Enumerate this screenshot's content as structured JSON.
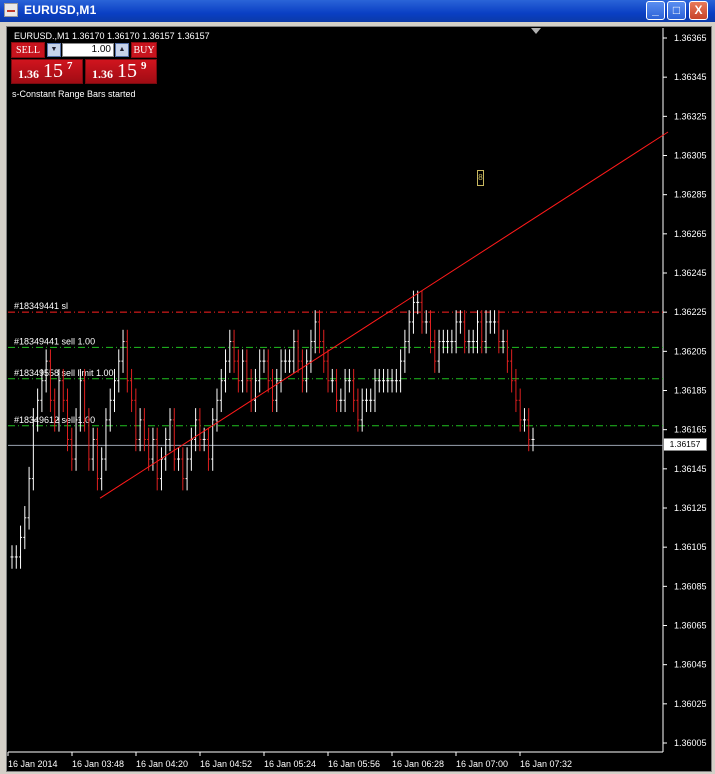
{
  "window": {
    "title": "EURUSD,M1",
    "minimize_label": "_",
    "maximize_label": "□",
    "close_label": "X"
  },
  "header": {
    "symbol_line": "EURUSD.,M1  1.36170 1.36170 1.36157 1.36157",
    "status": "s-Constant Range Bars started"
  },
  "one_click": {
    "sell_label": "SELL",
    "buy_label": "BUY",
    "lot": "1.00",
    "down_arrow": "▼",
    "up_arrow": "▲",
    "sell_quote": {
      "small": "1.36",
      "big": "15",
      "sup": "7"
    },
    "buy_quote": {
      "small": "1.36",
      "big": "15",
      "sup": "9"
    }
  },
  "price_tag": "1.36157",
  "warn_icon": "8",
  "colors": {
    "background": "#000000",
    "bar_red": "#e02020",
    "bar_white": "#ffffff",
    "trendline": "#ff1a1a",
    "sl_line": "#ff2020",
    "order_line": "#20c020",
    "bid_line": "#9aa3b0"
  },
  "price_axis": {
    "labels": [
      "1.36365",
      "1.36345",
      "1.36325",
      "1.36305",
      "1.36285",
      "1.36265",
      "1.36245",
      "1.36225",
      "1.36205",
      "1.36185",
      "1.36165",
      "1.36145",
      "1.36125",
      "1.36105",
      "1.36085",
      "1.36065",
      "1.36045",
      "1.36025",
      "1.36005"
    ]
  },
  "time_axis": {
    "labels": [
      "16 Jan 2014",
      "16 Jan 03:48",
      "16 Jan 04:20",
      "16 Jan 04:52",
      "16 Jan 05:24",
      "16 Jan 05:56",
      "16 Jan 06:28",
      "16 Jan 07:00",
      "16 Jan 07:32"
    ]
  },
  "order_lines": [
    {
      "label": "#18349441 sl",
      "price": 1.36225,
      "color": "#ff2020"
    },
    {
      "label": "#18349441 sell 1.00",
      "price": 1.36207,
      "color": "#20c020"
    },
    {
      "label": "#18349558 sell limit 1.00",
      "price": 1.36191,
      "color": "#20c020"
    },
    {
      "label": "#18349612 sell 1.00",
      "price": 1.36167,
      "color": "#20c020"
    }
  ],
  "chart_data": {
    "type": "bar",
    "symbol": "EURUSD.",
    "timeframe": "M1",
    "bid": 1.36157,
    "ylim": [
      1.36,
      1.36375
    ],
    "trendline": {
      "from": [
        0,
        1.3613
      ],
      "to": [
        1,
        1.36317
      ]
    },
    "closes": [
      1.361,
      1.361,
      1.3611,
      1.3612,
      1.3614,
      1.3617,
      1.3618,
      1.3619,
      1.362,
      1.3618,
      1.3617,
      1.3619,
      1.3618,
      1.3616,
      1.3615,
      1.3617,
      1.3619,
      1.3617,
      1.3615,
      1.3616,
      1.3614,
      1.3615,
      1.3617,
      1.3618,
      1.3619,
      1.362,
      1.3621,
      1.3619,
      1.3618,
      1.3616,
      1.3617,
      1.3616,
      1.3615,
      1.3616,
      1.3614,
      1.3615,
      1.3616,
      1.3617,
      1.3615,
      1.3615,
      1.3614,
      1.3615,
      1.3616,
      1.3617,
      1.3616,
      1.3616,
      1.3615,
      1.3617,
      1.3618,
      1.3619,
      1.362,
      1.3621,
      1.362,
      1.3619,
      1.362,
      1.3619,
      1.3618,
      1.3619,
      1.362,
      1.362,
      1.3619,
      1.3618,
      1.3619,
      1.362,
      1.362,
      1.362,
      1.3621,
      1.362,
      1.3619,
      1.362,
      1.3621,
      1.3622,
      1.3621,
      1.362,
      1.3619,
      1.3619,
      1.3618,
      1.3618,
      1.3619,
      1.3619,
      1.3618,
      1.3617,
      1.3618,
      1.3618,
      1.3618,
      1.3619,
      1.3619,
      1.3619,
      1.3619,
      1.3619,
      1.3619,
      1.362,
      1.3621,
      1.3622,
      1.3623,
      1.3623,
      1.3622,
      1.3622,
      1.3621,
      1.362,
      1.3621,
      1.3621,
      1.3621,
      1.3621,
      1.3622,
      1.3622,
      1.3621,
      1.3621,
      1.3621,
      1.3622,
      1.3621,
      1.3622,
      1.3622,
      1.3622,
      1.3621,
      1.3621,
      1.362,
      1.3619,
      1.3618,
      1.3617,
      1.3617,
      1.3616,
      1.3616
    ]
  }
}
